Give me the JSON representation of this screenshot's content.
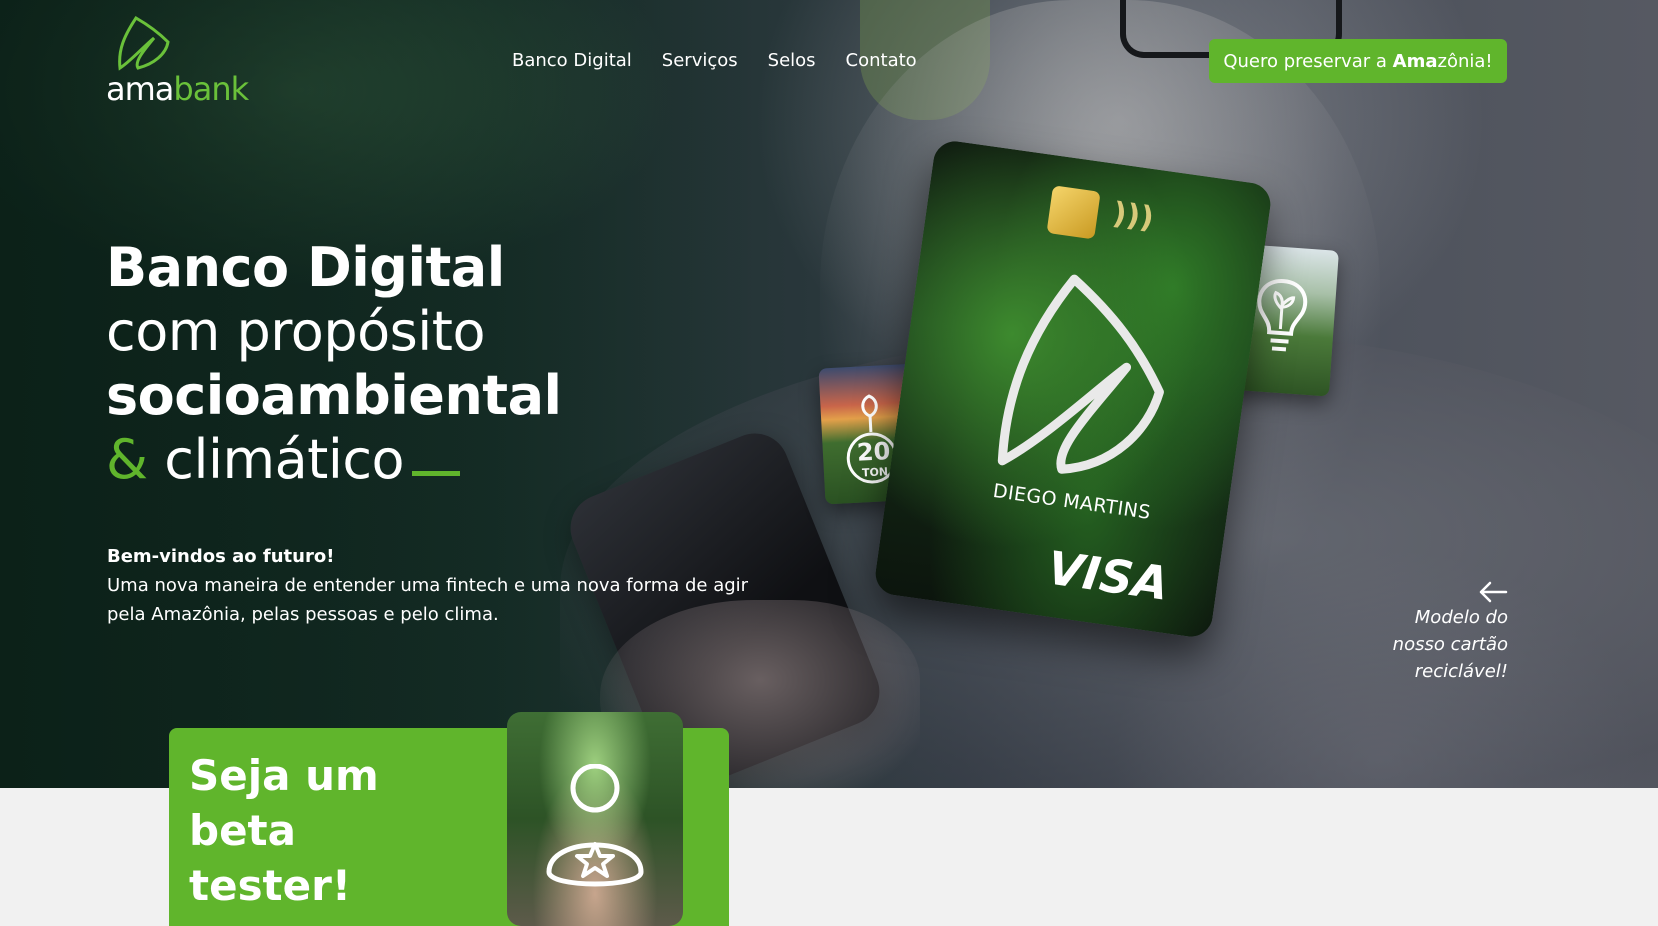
{
  "brand": {
    "logo_part1": "ama",
    "logo_part2": "bank"
  },
  "nav": {
    "items": [
      "Banco Digital",
      "Serviços",
      "Selos",
      "Contato"
    ]
  },
  "cta": {
    "text_before": "Quero preservar a ",
    "text_bold": "Ama",
    "text_after": "zônia!"
  },
  "hero": {
    "line1": "Banco Digital",
    "line2": "com propósito",
    "line3": "socioambiental",
    "line4_amp": "&",
    "line4_rest": "climático",
    "welcome": "Bem-vindos ao futuro!",
    "description": "Uma nova maneira de entender uma fintech e uma nova forma de agir pela Amazônia, pelas pessoas e pelo clima."
  },
  "card": {
    "holder_name": "DIEGO MARTINS",
    "brand": "VISA",
    "badge_number": "20",
    "badge_unit": "TON"
  },
  "caption": {
    "line1": "Modelo do",
    "line2": "nosso cartão",
    "line3": "reciclável!"
  },
  "beta": {
    "title": "Seja um beta tester!"
  },
  "colors": {
    "accent": "#60b52c",
    "logo_green": "#6ac13a"
  },
  "icons": [
    "leaf-logo-icon",
    "chip-icon",
    "contactless-icon",
    "seedling-badge-icon",
    "lightbulb-plant-icon",
    "arrow-left-icon",
    "user-star-icon"
  ]
}
